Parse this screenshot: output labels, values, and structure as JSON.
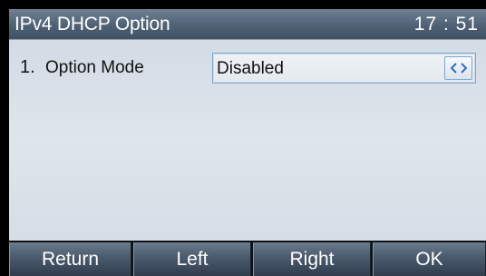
{
  "titlebar": {
    "title": "IPv4 DHCP Option",
    "clock": "17 : 51"
  },
  "menu": {
    "items": [
      {
        "number": "1.",
        "label": "Option Mode",
        "value": "Disabled",
        "control_icon": "left-right-switch-icon"
      }
    ]
  },
  "softkeys": {
    "return_label": "Return",
    "left_label": "Left",
    "right_label": "Right",
    "ok_label": "OK"
  },
  "colors": {
    "titlebar": "#4f6174",
    "content_background": "#dfe5ec",
    "field_border": "#7ea6cc",
    "softkey": "#4a5a6d",
    "switch_arrow": "#2f6fb5"
  }
}
